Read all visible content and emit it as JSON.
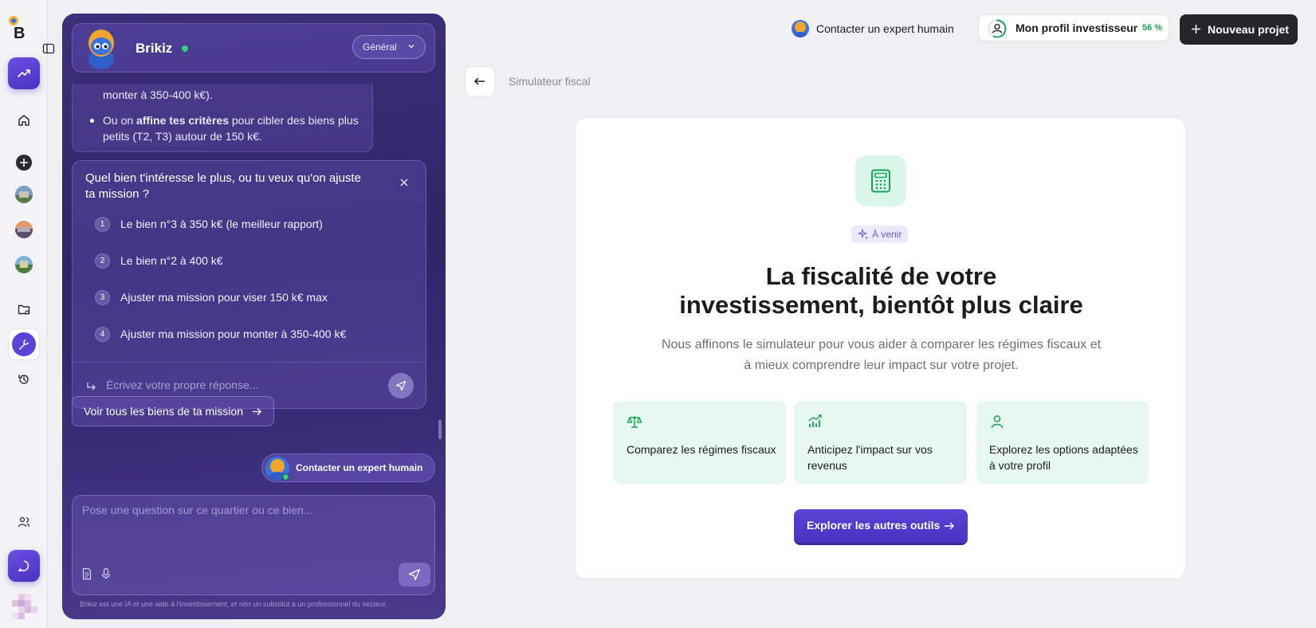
{
  "nav": {
    "items": [
      "trend-icon",
      "home-icon",
      "add-icon",
      "project-thumb-1",
      "project-thumb-2",
      "project-thumb-3",
      "folder-icon",
      "tools-icon",
      "history-icon",
      "users-icon",
      "chat-icon"
    ]
  },
  "chat": {
    "bot_name": "Brikiz",
    "mode_select": "Général",
    "prev_message": {
      "line1": "monter à 350-400 k€).",
      "bullet_prefix": "Ou on ",
      "bullet_bold": "affine tes critères",
      "bullet_suffix": " pour cibler des biens plus petits (T2, T3) autour de 150 k€."
    },
    "question": "Quel bien t'intéresse le plus, ou tu veux qu'on ajuste ta mission ?",
    "options": [
      {
        "num": "1",
        "label": "Le bien n°3 à 350 k€ (le meilleur rapport)"
      },
      {
        "num": "2",
        "label": "Le bien n°2 à 400 k€"
      },
      {
        "num": "3",
        "label": "Ajuster ma mission pour viser 150 k€ max"
      },
      {
        "num": "4",
        "label": "Ajuster ma mission pour monter à 350-400 k€"
      }
    ],
    "reply_placeholder": "Écrivez votre propre réponse...",
    "see_all": "Voir tous les biens de ta mission",
    "expert_pill": "Contacter un expert humain",
    "composer_placeholder": "Pose une question sur ce quartier ou ce bien...",
    "disclaimer": "Brikiz est une IA et une aide à l'investissement, et non un substitut à un professionnel du secteur."
  },
  "topbar": {
    "expert": "Contacter un expert humain",
    "profile": "Mon profil investisseur",
    "profile_pct": "56 %",
    "profile_progress": 0.56,
    "new_project": "Nouveau projet"
  },
  "page": {
    "breadcrumb": "Simulateur fiscal",
    "badge": "À venir",
    "headline_1": "La fiscalité de votre",
    "headline_2": "investissement, bientôt plus claire",
    "sub_1": "Nous affinons le simulateur pour vous aider à comparer les régimes fiscaux et",
    "sub_2": "à mieux comprendre leur impact sur votre projet.",
    "features": [
      {
        "icon": "scale-icon",
        "label": "Comparez les régimes fiscaux"
      },
      {
        "icon": "chart-icon",
        "label": "Anticipez l'impact sur vos revenus"
      },
      {
        "icon": "user-icon",
        "label": "Explorez les options adaptées à votre profil"
      }
    ],
    "cta": "Explorer les autres outils"
  },
  "colors": {
    "accent": "#4a32c4",
    "panel": "#2e2568",
    "success": "#17a35a",
    "mint": "#e6f8ef"
  }
}
